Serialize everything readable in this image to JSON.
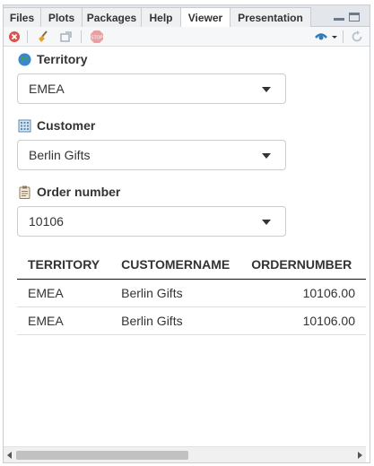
{
  "tabs": [
    {
      "label": "Files",
      "active": false
    },
    {
      "label": "Plots",
      "active": false
    },
    {
      "label": "Packages",
      "active": false
    },
    {
      "label": "Help",
      "active": false
    },
    {
      "label": "Viewer",
      "active": true
    },
    {
      "label": "Presentation",
      "active": false
    }
  ],
  "toolbar": {
    "icons": [
      "remove-icon",
      "clear-broom-icon",
      "popout-icon",
      "stop-icon",
      "publish-icon",
      "refresh-icon"
    ]
  },
  "filters": [
    {
      "label": "Territory",
      "icon": "globe-icon",
      "value": "EMEA"
    },
    {
      "label": "Customer",
      "icon": "building-icon",
      "value": "Berlin Gifts"
    },
    {
      "label": "Order number",
      "icon": "clipboard-icon",
      "value": "10106"
    }
  ],
  "table": {
    "columns": [
      "TERRITORY",
      "CUSTOMERNAME",
      "ORDERNUMBER"
    ],
    "rows": [
      [
        "EMEA",
        "Berlin Gifts",
        "10106.00"
      ],
      [
        "EMEA",
        "Berlin Gifts",
        "10106.00"
      ]
    ]
  },
  "colors": {
    "accent": "#2f7ab8",
    "stop": "#d9534f",
    "remove": "#d9534f"
  }
}
